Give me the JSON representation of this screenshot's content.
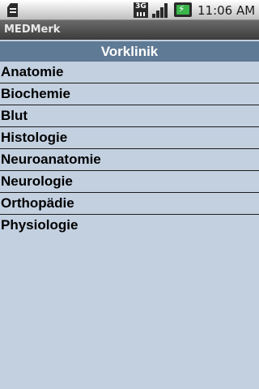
{
  "status_bar": {
    "network_label": "3G",
    "time": "11:06 AM",
    "icons": [
      "sd-card-icon",
      "network-3g-icon",
      "signal-strength-icon",
      "battery-charging-icon"
    ]
  },
  "app": {
    "title": "MEDMerk"
  },
  "section": {
    "title": "Vorklinik"
  },
  "list": {
    "items": [
      "Anatomie",
      "Biochemie",
      "Blut",
      "Histologie",
      "Neuroanatomie",
      "Neurologie",
      "Orthopädie",
      "Physiologie"
    ]
  },
  "colors": {
    "background": "#c3d0e0",
    "section_header": "#5f7a94",
    "title_bar": "#4a4a4a"
  }
}
